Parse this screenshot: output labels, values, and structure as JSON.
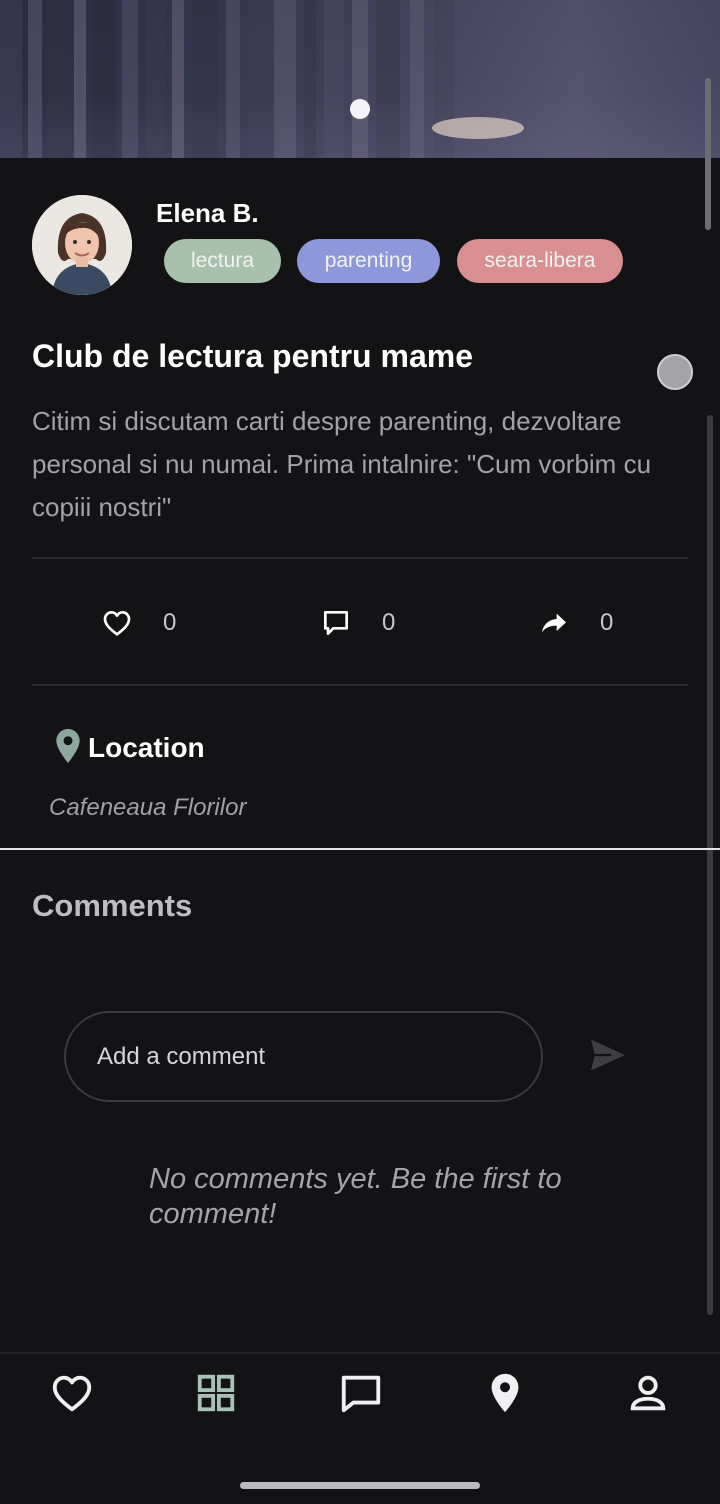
{
  "post": {
    "author": "Elena B.",
    "tags": [
      "lectura",
      "parenting",
      "seara-libera"
    ],
    "title": "Club de lectura pentru mame",
    "description": "Citim si discutam carti despre parenting, dezvoltare personal si nu numai. Prima intalnire: \"Cum vorbim cu copiii nostri\"",
    "likes": "0",
    "comments": "0",
    "shares": "0"
  },
  "location": {
    "label": "Location",
    "value": "Cafeneaua Florilor"
  },
  "comments_section": {
    "title": "Comments",
    "placeholder": "Add a comment",
    "empty_text": "No comments yet. Be the first to comment!"
  },
  "colors": {
    "background": "#131214",
    "tag_lectura": "#a7c1ac",
    "tag_parenting": "#8d98da",
    "tag_seara_libera": "#d98f8f"
  },
  "icons": {
    "actions": [
      "heart-icon",
      "comment-icon",
      "share-icon"
    ],
    "location": "map-pin-icon",
    "send": "send-icon",
    "bottom_nav": [
      "heart-icon",
      "grid-icon",
      "chat-icon",
      "map-pin-icon",
      "profile-icon"
    ]
  }
}
